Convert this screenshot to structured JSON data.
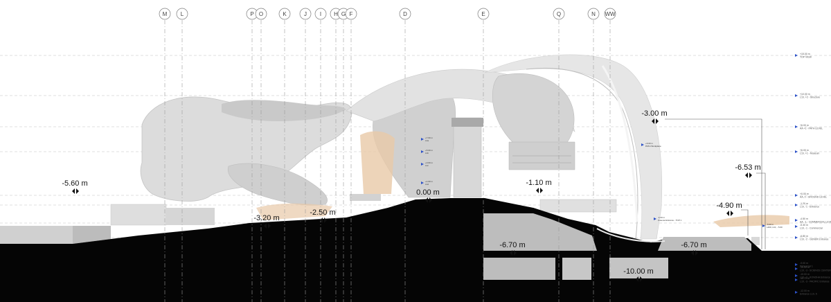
{
  "grid_labels": [
    "M",
    "L",
    "P",
    "O",
    "K",
    "J",
    "I",
    "H",
    "G",
    "F",
    "D",
    "E",
    "Q",
    "N",
    "WW"
  ],
  "level_marks": [
    "-5.60 m",
    "-3.20 m",
    "-2.50 m",
    "0.00 m",
    "-1.10 m",
    "-3.00 m",
    "-6.53 m",
    "-4.90 m",
    "-6.70 m",
    "-6.70 m",
    "-10.00 m"
  ],
  "right_levels": [
    {
      "value": "+15.00 m",
      "name": "TOP VIEW"
    },
    {
      "value": "+10.00 m",
      "name": "L10, +2 - Structure"
    },
    {
      "value": "+6.00 m",
      "name": "AA +1 - PATH LEVEL"
    },
    {
      "value": "+6.00 m",
      "name": "L10, +1 - Museum"
    },
    {
      "value": "+0.00 m",
      "name": "AA, 0 - GROUND LEVEL"
    },
    {
      "value": "-1.20 m",
      "name": "L10, -1 - Entrance"
    },
    {
      "value": "-4.50 m",
      "name": "AA, -1 - COMMERCIAL LEVEL"
    },
    {
      "value": "-5.30 m",
      "name": "L10, -1 - Commercial"
    },
    {
      "value": "-6.80 m",
      "name": "L10, -2 - GENER Entrance"
    },
    {
      "value": "-9.00 m",
      "name": "Rehearsal 1"
    },
    {
      "value": "-10.00 m",
      "name": "L10, -3 - SCIENCE CENTER"
    },
    {
      "value": "-10.00 m",
      "name": "L10, -3 - KONOHA Entrance"
    },
    {
      "value": "-10.70 m",
      "name": "L10, -3 - PACIFIC Entrance"
    },
    {
      "value": "-12.00 m",
      "name": "Entrance L10, 5"
    }
  ],
  "inner_tags": [
    {
      "value": "+7.00 m",
      "name": "L1a"
    },
    {
      "value": "+5.00 m",
      "name": "L1b"
    },
    {
      "value": "+3.00 m",
      "name": "L1c"
    },
    {
      "value": "+1.00 m",
      "name": "L1d"
    },
    {
      "value": "+6.00 m",
      "name": "PATH Workplane"
    },
    {
      "value": "-1.00 m",
      "name": "Kusena Entrance - TOP 1"
    },
    {
      "value": "-5.00 m",
      "name": "L400, L10, - 5.00"
    }
  ],
  "colors": {
    "ground": "#050505",
    "shell": "#d6d6d6",
    "shell_dark": "#bdbdbd",
    "accent": "#e8c9a8",
    "gridline": "#bbbbbb",
    "level_dot": "#2d52c8"
  }
}
